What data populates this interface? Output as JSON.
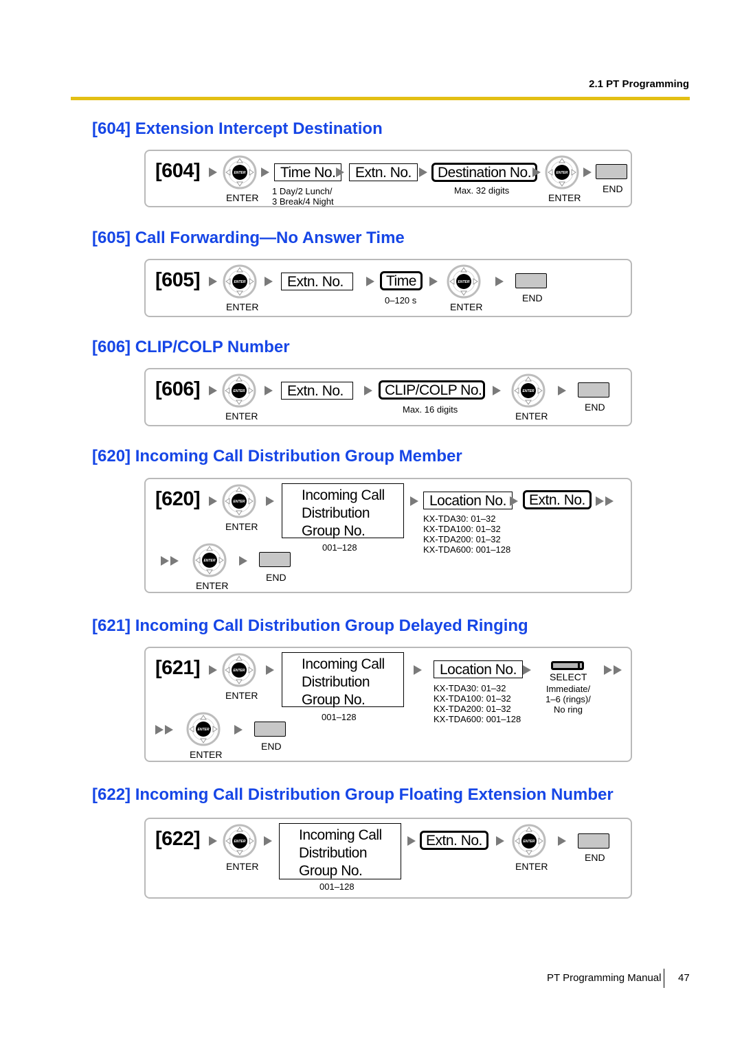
{
  "header": {
    "section": "2.1 PT Programming",
    "rule_color": "#e3bf14"
  },
  "common": {
    "enter_label": "ENTER",
    "enter_key_text": "ENTER",
    "end_label": "END",
    "select_label": "SELECT"
  },
  "sections": [
    {
      "title": "[604] Extension Intercept Destination",
      "code": "[604]",
      "steps": {
        "time_no": "Time No.",
        "time_note_line1": "1 Day/2 Lunch/",
        "time_note_line2": "3 Break/4 Night",
        "extn_no": "Extn. No.",
        "destination_no": "Destination No.",
        "destination_note": "Max. 32 digits"
      }
    },
    {
      "title": "[605] Call Forwarding—No Answer Time",
      "code": "[605]",
      "steps": {
        "extn_no": "Extn. No.",
        "time": "Time",
        "time_note": "0–120 s"
      }
    },
    {
      "title": "[606] CLIP/COLP Number",
      "code": "[606]",
      "steps": {
        "extn_no": "Extn. No.",
        "clip_colp_no": "CLIP/COLP No.",
        "clip_note": "Max. 16 digits"
      }
    },
    {
      "title": "[620] Incoming Call Distribution Group Member",
      "code": "[620]",
      "steps": {
        "group_line1": "Incoming Call",
        "group_line2": "Distribution",
        "group_line3": "Group No.",
        "group_note": "001–128",
        "location_no": "Location No.",
        "location_notes": [
          "KX-TDA30: 01–32",
          "KX-TDA100: 01–32",
          "KX-TDA200: 01–32",
          "KX-TDA600: 001–128"
        ],
        "extn_no": "Extn. No."
      }
    },
    {
      "title": "[621] Incoming Call Distribution Group Delayed Ringing",
      "code": "[621]",
      "steps": {
        "group_line1": "Incoming Call",
        "group_line2": "Distribution",
        "group_line3": "Group No.",
        "group_note": "001–128",
        "location_no": "Location No.",
        "location_notes": [
          "KX-TDA30: 01–32",
          "KX-TDA100: 01–32",
          "KX-TDA200: 01–32",
          "KX-TDA600: 001–128"
        ],
        "select_notes": [
          "Immediate/",
          "1–6 (rings)/",
          "No ring"
        ]
      }
    },
    {
      "title": "[622] Incoming Call Distribution Group Floating Extension Number",
      "code": "[622]",
      "steps": {
        "group_line1": "Incoming Call",
        "group_line2": "Distribution",
        "group_line3": "Group No.",
        "group_note": "001–128",
        "extn_no": "Extn. No."
      }
    }
  ],
  "footer": {
    "manual_title": "PT Programming Manual",
    "page_number": "47"
  }
}
